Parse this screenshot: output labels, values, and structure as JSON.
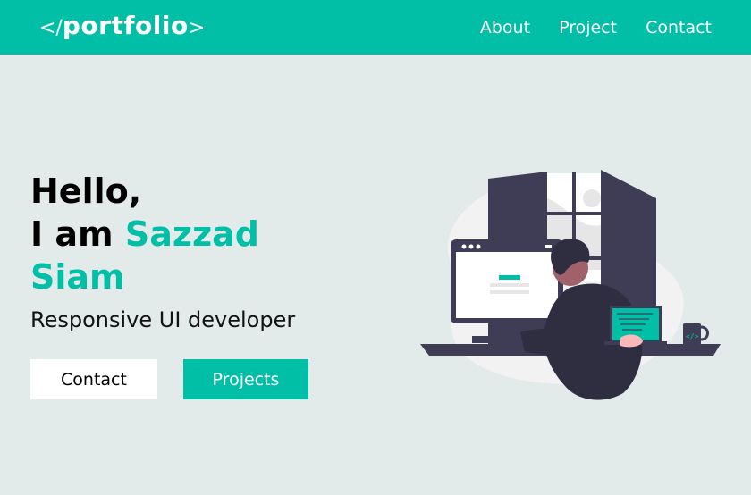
{
  "brand": {
    "logo_open": "</",
    "logo_word": "portfolio",
    "logo_close": ">"
  },
  "nav": {
    "items": [
      {
        "label": "About"
      },
      {
        "label": "Project"
      },
      {
        "label": "Contact"
      }
    ]
  },
  "hero": {
    "greeting_line1": "Hello,",
    "greeting_prefix": "I am ",
    "name_first": "Sazzad",
    "name_last": "Siam",
    "role": "Responsive UI developer"
  },
  "buttons": {
    "contact_label": "Contact",
    "projects_label": "Projects"
  },
  "colors": {
    "accent": "#00bfa6",
    "background": "#e3ebea",
    "dark": "#3f3d56"
  },
  "illustration": {
    "icon": "developer-at-desk-illustration"
  }
}
